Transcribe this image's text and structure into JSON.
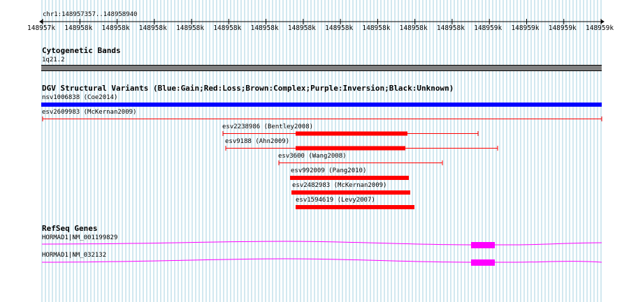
{
  "ruler": {
    "location": "chr1:148957357..148958940",
    "ticks": [
      "148957k",
      "148958k",
      "148958k",
      "148958k",
      "148958k",
      "148958k",
      "148958k",
      "148958k",
      "148958k",
      "148958k",
      "148958k",
      "148958k",
      "148959k",
      "148959k",
      "148959k",
      "148959k"
    ]
  },
  "cytoband": {
    "title": "Cytogenetic Bands",
    "band": "1q21.2"
  },
  "dgv": {
    "title": "DGV Structural Variants (Blue:Gain;Red:Loss;Brown:Complex;Purple:Inversion;Black:Unknown)",
    "features": [
      {
        "label": "nsv1006838 (Coe2014)"
      },
      {
        "label": "esv2609983 (McKernan2009)"
      },
      {
        "label": "esv2238986 (Bentley2008)"
      },
      {
        "label": "esv9188 (Ahn2009)"
      },
      {
        "label": "esv3600 (Wang2008)"
      },
      {
        "label": "esv992009 (Pang2010)"
      },
      {
        "label": "esv2482983 (McKernan2009)"
      },
      {
        "label": "esv1594619 (Levy2007)"
      }
    ]
  },
  "refseq": {
    "title": "RefSeq Genes",
    "genes": [
      {
        "label": "HORMAD1|NM_001199829"
      },
      {
        "label": "HORMAD1|NM_032132"
      }
    ]
  },
  "colors": {
    "gain": "#0000ff",
    "loss": "#ff0000",
    "gene": "#ff00ff",
    "band": "#808080",
    "grid": "#a6d2e2"
  }
}
